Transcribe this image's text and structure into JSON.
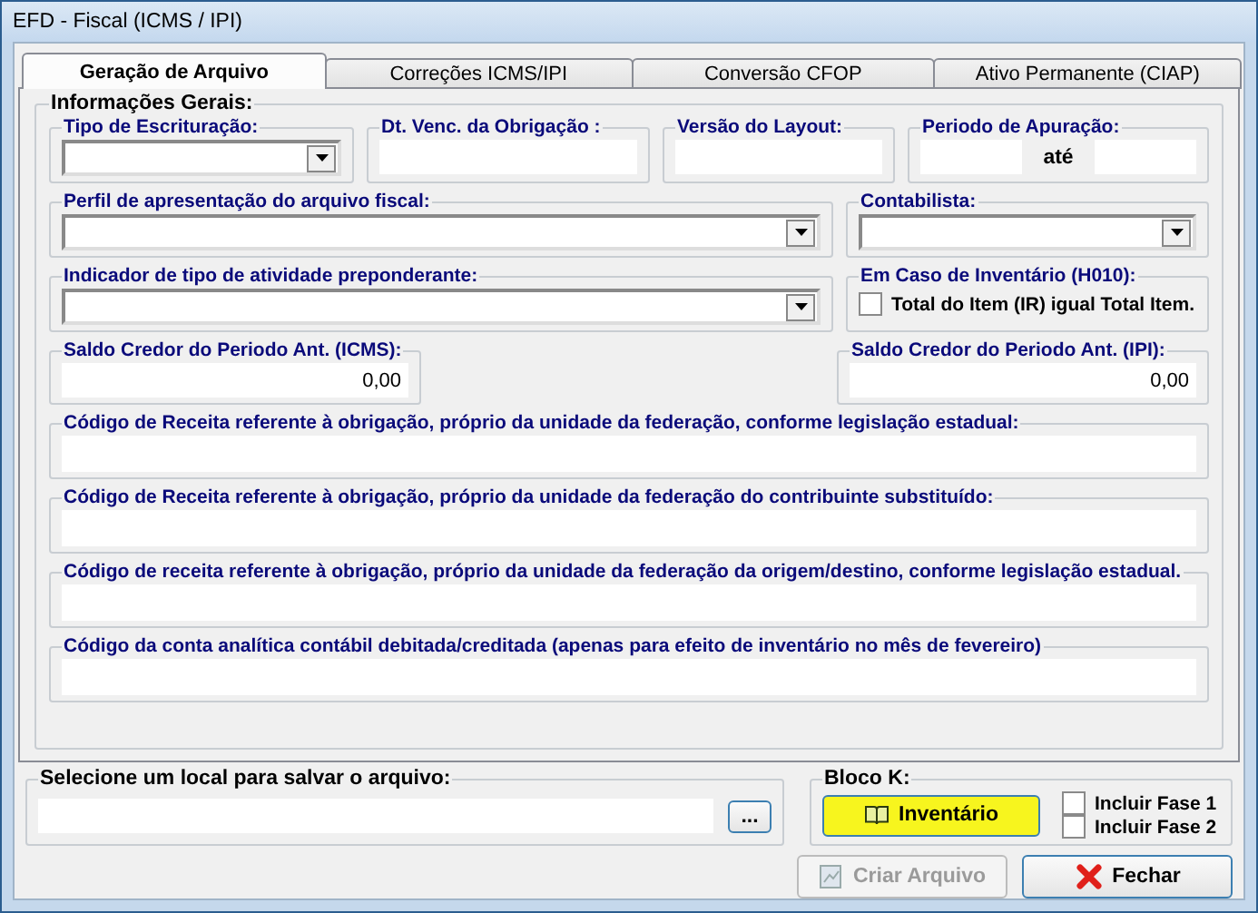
{
  "window": {
    "title": "EFD - Fiscal (ICMS / IPI)"
  },
  "tabs": [
    {
      "label": "Geração de Arquivo",
      "selected": true
    },
    {
      "label": "Correções ICMS/IPI",
      "selected": false
    },
    {
      "label": "Conversão CFOP",
      "selected": false
    },
    {
      "label": "Ativo Permanente (CIAP)",
      "selected": false
    }
  ],
  "general_info": {
    "title": "Informações Gerais:",
    "rows": [
      {
        "groups": [
          {
            "kind": "dropdown",
            "label": "Tipo de Escrituração:"
          },
          {
            "kind": "text",
            "label": "Dt. Venc. da Obrigação :"
          },
          {
            "kind": "text",
            "label": "Versão do Layout:"
          },
          {
            "kind": "range",
            "label": "Periodo de Apuração:",
            "separator": "até"
          }
        ]
      },
      {
        "groups": [
          {
            "kind": "dropdown",
            "label": "Perfil de apresentação do arquivo fiscal:"
          },
          {
            "kind": "dropdown",
            "label": "Contabilista:"
          }
        ]
      },
      {
        "groups": [
          {
            "kind": "dropdown",
            "label": "Indicador de tipo de atividade preponderante:"
          },
          {
            "kind": "checkbox",
            "label": "Em Caso de Inventário (H010):",
            "option": "Total do Item (IR) igual Total Item.",
            "checked": false
          }
        ]
      },
      {
        "groups": [
          {
            "kind": "number",
            "label": "Saldo Credor do Periodo Ant. (ICMS):",
            "value": "0,00"
          },
          {
            "kind": "spacer"
          },
          {
            "kind": "number",
            "label": "Saldo Credor do Periodo Ant. (IPI):",
            "value": "0,00"
          }
        ]
      },
      {
        "groups": [
          {
            "kind": "text",
            "label": "Código de Receita referente à obrigação, próprio da unidade da federação, conforme legislação estadual:"
          }
        ]
      },
      {
        "groups": [
          {
            "kind": "text",
            "label": "Código de Receita referente à obrigação, próprio da unidade da federação do contribuinte substituído:"
          }
        ]
      },
      {
        "groups": [
          {
            "kind": "text",
            "label": "Código de receita referente à obrigação, próprio da unidade da federação da origem/destino, conforme legislação estadual."
          }
        ]
      },
      {
        "groups": [
          {
            "kind": "text",
            "label": "Código da conta analítica contábil debitada/creditada (apenas para efeito de inventário no mês de fevereiro)"
          }
        ]
      }
    ]
  },
  "save_location": {
    "label": "Selecione um local para salvar o arquivo:",
    "browse_button": "..."
  },
  "bloco_k": {
    "title": "Bloco K:",
    "button": "Inventário",
    "options": [
      {
        "label": "Incluir Fase 1",
        "checked": false
      },
      {
        "label": "Incluir Fase 2",
        "checked": false
      }
    ]
  },
  "buttons": [
    {
      "kind": "create",
      "label": "Criar Arquivo",
      "disabled": true
    },
    {
      "kind": "close",
      "label": "Fechar",
      "disabled": false
    }
  ]
}
